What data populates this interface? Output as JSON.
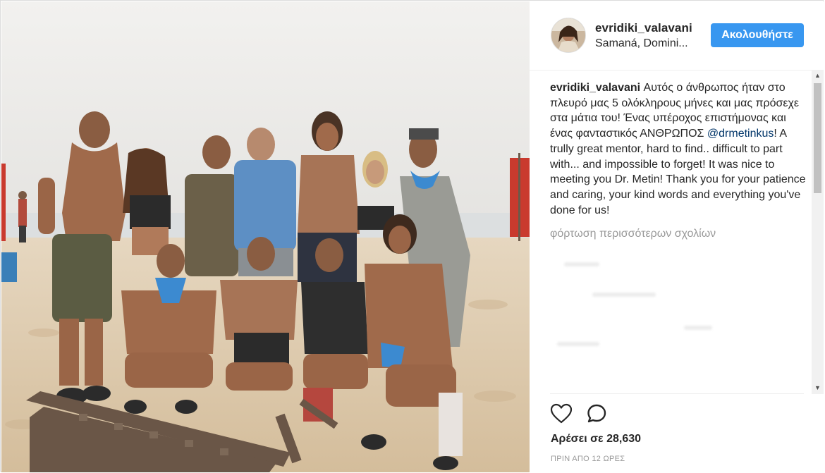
{
  "post": {
    "username": "evridiki_valavani",
    "location": "Samaná, Domini...",
    "follow_label": "Ακολουθήστε",
    "caption": {
      "username": "evridiki_valavani",
      "text_before_mention": "Αυτός ο άνθρωπος ήταν στο πλευρό μας 5 ολόκληρους μήνες και μας πρόσεχε στα μάτια του! Ένας υπέροχος επιστήμονας και ένας φανταστικός ΑΝΘΡΩΠΟΣ",
      "mention": "@drmetinkus",
      "text_after_mention": "! A trully great mentor, hard to find.. difficult to part with... and impossible to forget! It was nice to meeting you Dr. Metin! Thank you for your patience and caring, your kind words and everything you've done for us!"
    },
    "load_more_comments": "φόρτωση περισσότερων σχολίων",
    "likes": "Αρέσει σε 28,630",
    "timestamp": "ΠΡΙΝ ΑΠΟ 12 ΩΡΕΣ"
  },
  "icons": {
    "like": "heart-outline-icon",
    "comment": "speech-bubble-outline-icon",
    "scroll_up": "triangle-up-icon",
    "scroll_down": "triangle-down-icon"
  },
  "colors": {
    "follow_button": "#3897f0",
    "mention": "#003569",
    "secondary_text": "#999999",
    "primary_text": "#262626"
  }
}
